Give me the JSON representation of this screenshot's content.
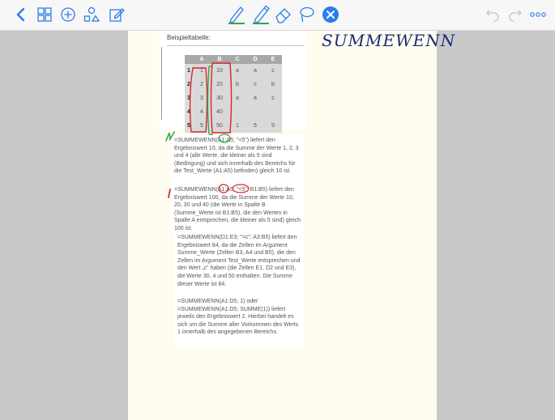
{
  "toolbar": {
    "left_icons": [
      "chevron-left-icon",
      "grid-icon",
      "add-circle-icon",
      "shapes-icon",
      "edit-icon"
    ],
    "center_icons": [
      "pencil-icon",
      "pen-icon",
      "eraser-icon",
      "lasso-icon",
      "close-circle-icon"
    ],
    "right_icons": [
      "undo-icon",
      "redo-icon",
      "more-icon"
    ],
    "accent_color": "#2b7de9",
    "active_pen_color": "#2fa84f"
  },
  "page": {
    "handwritten_title": "SUMMEWENN",
    "table_label": "Beispieltabelle:",
    "table": {
      "columns": [
        "A",
        "B",
        "C",
        "D",
        "E"
      ],
      "rows": [
        {
          "num": "1",
          "cells": [
            "1",
            "10",
            "a",
            "a",
            "c"
          ]
        },
        {
          "num": "2",
          "cells": [
            "2",
            "20",
            "b",
            "c",
            "b"
          ]
        },
        {
          "num": "3",
          "cells": [
            "3",
            "30",
            "a",
            "a",
            "c"
          ]
        },
        {
          "num": "4",
          "cells": [
            "4",
            "40",
            "",
            "",
            ""
          ]
        },
        {
          "num": "5",
          "cells": [
            "5",
            "50",
            "1",
            "5",
            "9"
          ]
        }
      ]
    },
    "paragraphs": [
      "=SUMMEWENN(A1:A5; \"<5\") liefert den Ergebniswert 10, da die Summe der Werte 1, 2, 3 und 4 (alle Werte, die kleiner als 5 sind (Bedingung) und sich innerhalb des Bereichs für die Test_Werte (A1:A5) befinden) gleich 10 ist.",
      "=SUMMEWENN(A1:A5; \"<5\"; B1:B5) liefert den Ergebniswert 100, da die Summe der Werte 10, 20, 30 und 40 (die Werte in Spalte B (Summe_Werte ist B1:B5), die den Werten in Spalte A entsprechen, die kleiner als 5 sind) gleich 100 ist.",
      "=SUMMEWENN(D1:E3; \"=c\"; A3:B5) liefert den Ergebniswert 84, da die Zellen im Argument Summe_Werte (Zellen B3, A4 und B5), die den Zellen im Argument Test_Werte entsprechen und den Wert „c\" haben (die Zellen E1, D2 und E3), die Werte 30, 4 und 50 enthalten. Die Summe dieser Werte ist 84.",
      "=SUMMEWENN(A1:D5; 1) oder =SUMMEWENN(A1:D5; SUMME(1)) liefert jeweils den Ergebniswert 2. Hierbei handelt es sich um die Summe aller Vorkommen des Werts 1 innerhalb des angegebenen Bereichs."
    ]
  }
}
